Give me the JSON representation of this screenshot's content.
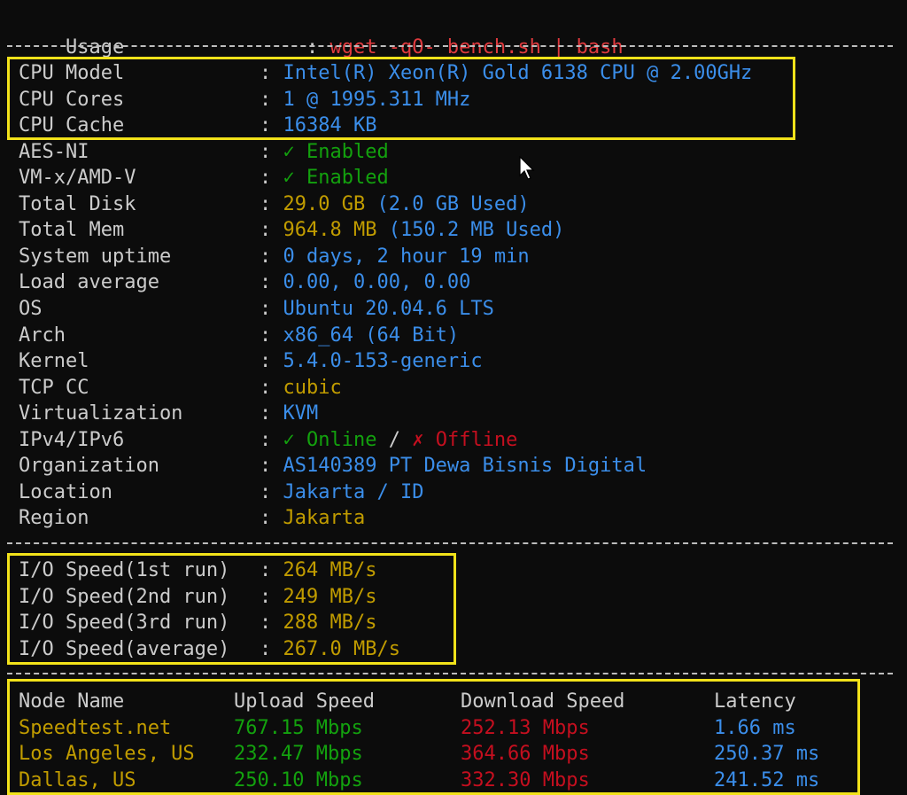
{
  "usage": {
    "key": "Usage",
    "value": "wget -qO- bench.sh | bash"
  },
  "separator_char": "-",
  "sysinfo": [
    {
      "key": "CPU Model",
      "parts": [
        {
          "text": "Intel(R) Xeon(R) Gold 6138 CPU @ 2.00GHz",
          "color": "#3b8eea"
        }
      ]
    },
    {
      "key": "CPU Cores",
      "parts": [
        {
          "text": "1 @ 1995.311 MHz",
          "color": "#3b8eea"
        }
      ]
    },
    {
      "key": "CPU Cache",
      "parts": [
        {
          "text": "16384 KB",
          "color": "#3b8eea"
        }
      ]
    },
    {
      "key": "AES-NI",
      "parts": [
        {
          "text": "✓ Enabled",
          "color": "#13a10e"
        }
      ]
    },
    {
      "key": "VM-x/AMD-V",
      "parts": [
        {
          "text": "✓ Enabled",
          "color": "#13a10e"
        }
      ]
    },
    {
      "key": "Total Disk",
      "parts": [
        {
          "text": "29.0 GB",
          "color": "#c19c00"
        },
        {
          "text": " (2.0 GB Used)",
          "color": "#3b8eea"
        }
      ]
    },
    {
      "key": "Total Mem",
      "parts": [
        {
          "text": "964.8 MB",
          "color": "#c19c00"
        },
        {
          "text": " (150.2 MB Used)",
          "color": "#3b8eea"
        }
      ]
    },
    {
      "key": "System uptime",
      "parts": [
        {
          "text": "0 days, 2 hour 19 min",
          "color": "#3b8eea"
        }
      ]
    },
    {
      "key": "Load average",
      "parts": [
        {
          "text": "0.00, 0.00, 0.00",
          "color": "#3b8eea"
        }
      ]
    },
    {
      "key": "OS",
      "parts": [
        {
          "text": "Ubuntu 20.04.6 LTS",
          "color": "#3b8eea"
        }
      ]
    },
    {
      "key": "Arch",
      "parts": [
        {
          "text": "x86_64 (64 Bit)",
          "color": "#3b8eea"
        }
      ]
    },
    {
      "key": "Kernel",
      "parts": [
        {
          "text": "5.4.0-153-generic",
          "color": "#3b8eea"
        }
      ]
    },
    {
      "key": "TCP CC",
      "parts": [
        {
          "text": "cubic",
          "color": "#c19c00"
        }
      ]
    },
    {
      "key": "Virtualization",
      "parts": [
        {
          "text": "KVM",
          "color": "#3b8eea"
        }
      ]
    },
    {
      "key": "IPv4/IPv6",
      "parts": [
        {
          "text": "✓ Online",
          "color": "#13a10e"
        },
        {
          "text": " / ",
          "color": "#cccccc"
        },
        {
          "text": "✗ Offline",
          "color": "#c50f1f"
        }
      ]
    },
    {
      "key": "Organization",
      "parts": [
        {
          "text": "AS140389 PT Dewa Bisnis Digital",
          "color": "#3b8eea"
        }
      ]
    },
    {
      "key": "Location",
      "parts": [
        {
          "text": "Jakarta / ID",
          "color": "#3b8eea"
        }
      ]
    },
    {
      "key": "Region",
      "parts": [
        {
          "text": "Jakarta",
          "color": "#c19c00"
        }
      ]
    }
  ],
  "io": [
    {
      "key": "I/O Speed(1st run)",
      "value": "264 MB/s"
    },
    {
      "key": "I/O Speed(2nd run)",
      "value": "249 MB/s"
    },
    {
      "key": "I/O Speed(3rd run)",
      "value": "288 MB/s"
    },
    {
      "key": "I/O Speed(average)",
      "value": "267.0 MB/s"
    }
  ],
  "speed_table": {
    "headers": [
      "Node Name",
      "Upload Speed",
      "Download Speed",
      "Latency"
    ],
    "rows": [
      [
        "Speedtest.net",
        "767.15 Mbps",
        "252.13 Mbps",
        "1.66 ms"
      ],
      [
        "Los Angeles, US",
        "232.47 Mbps",
        "364.66 Mbps",
        "250.37 ms"
      ],
      [
        "Dallas, US",
        "250.10 Mbps",
        "332.30 Mbps",
        "241.52 ms"
      ]
    ]
  },
  "colors": {
    "background": "#0c0c0c",
    "text": "#cccccc",
    "red": "#e03a3e",
    "blue": "#3b8eea",
    "green": "#13a10e",
    "yellow": "#c19c00",
    "highlight_box": "#f2e21a"
  }
}
